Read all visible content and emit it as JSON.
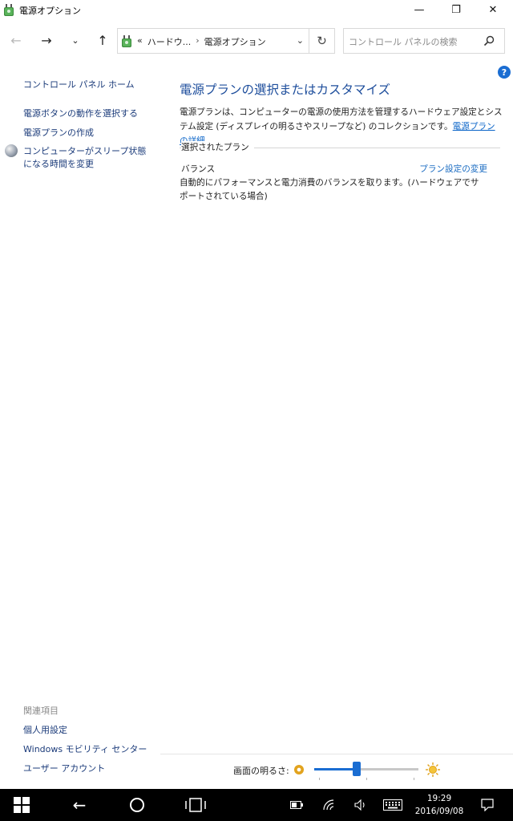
{
  "window": {
    "title": "電源オプション",
    "minimize_glyph": "—",
    "maximize_glyph": "❐",
    "close_glyph": "✕"
  },
  "nav": {
    "back_glyph": "←",
    "forward_glyph": "→",
    "recent_glyph": "⌄",
    "up_glyph": "↑",
    "breadcrumb_prefix": "«",
    "breadcrumbs": [
      "ハードウ...",
      "電源オプション"
    ],
    "breadcrumb_separator": "›",
    "dropdown_glyph": "⌄",
    "refresh_glyph": "↻",
    "search_placeholder": "コントロール パネルの検索"
  },
  "help_glyph": "?",
  "sidebar": {
    "home": "コントロール パネル ホーム",
    "items": [
      "電源ボタンの動作を選択する",
      "電源プランの作成",
      "コンピューターがスリープ状態になる時間を変更"
    ]
  },
  "related": {
    "heading": "関連項目",
    "items": [
      "個人用設定",
      "Windows モビリティ センター",
      "ユーザー アカウント"
    ]
  },
  "main": {
    "heading": "電源プランの選択またはカスタマイズ",
    "description": "電源プランは、コンピューターの電源の使用方法を管理するハードウェア設定とシステム設定 (ディスプレイの明るさやスリープなど) のコレクションです。",
    "details_link": "電源プランの詳細",
    "selected_plan_heading": "選択されたプラン",
    "plan_name": "バランス",
    "plan_change_link": "プラン設定の変更",
    "plan_description": "自動的にパフォーマンスと電力消費のバランスを取ります。(ハードウェアでサポートされている場合)"
  },
  "brightness": {
    "label": "画面の明るさ:",
    "level_fraction": 0.41
  },
  "taskbar": {
    "back_glyph": "←",
    "time": "19:29",
    "date": "2016/09/08"
  },
  "colors": {
    "accent": "#1a6dd2",
    "heading": "#1e4e9c",
    "link": "#1b3b7a",
    "taskbar": "#000000"
  }
}
